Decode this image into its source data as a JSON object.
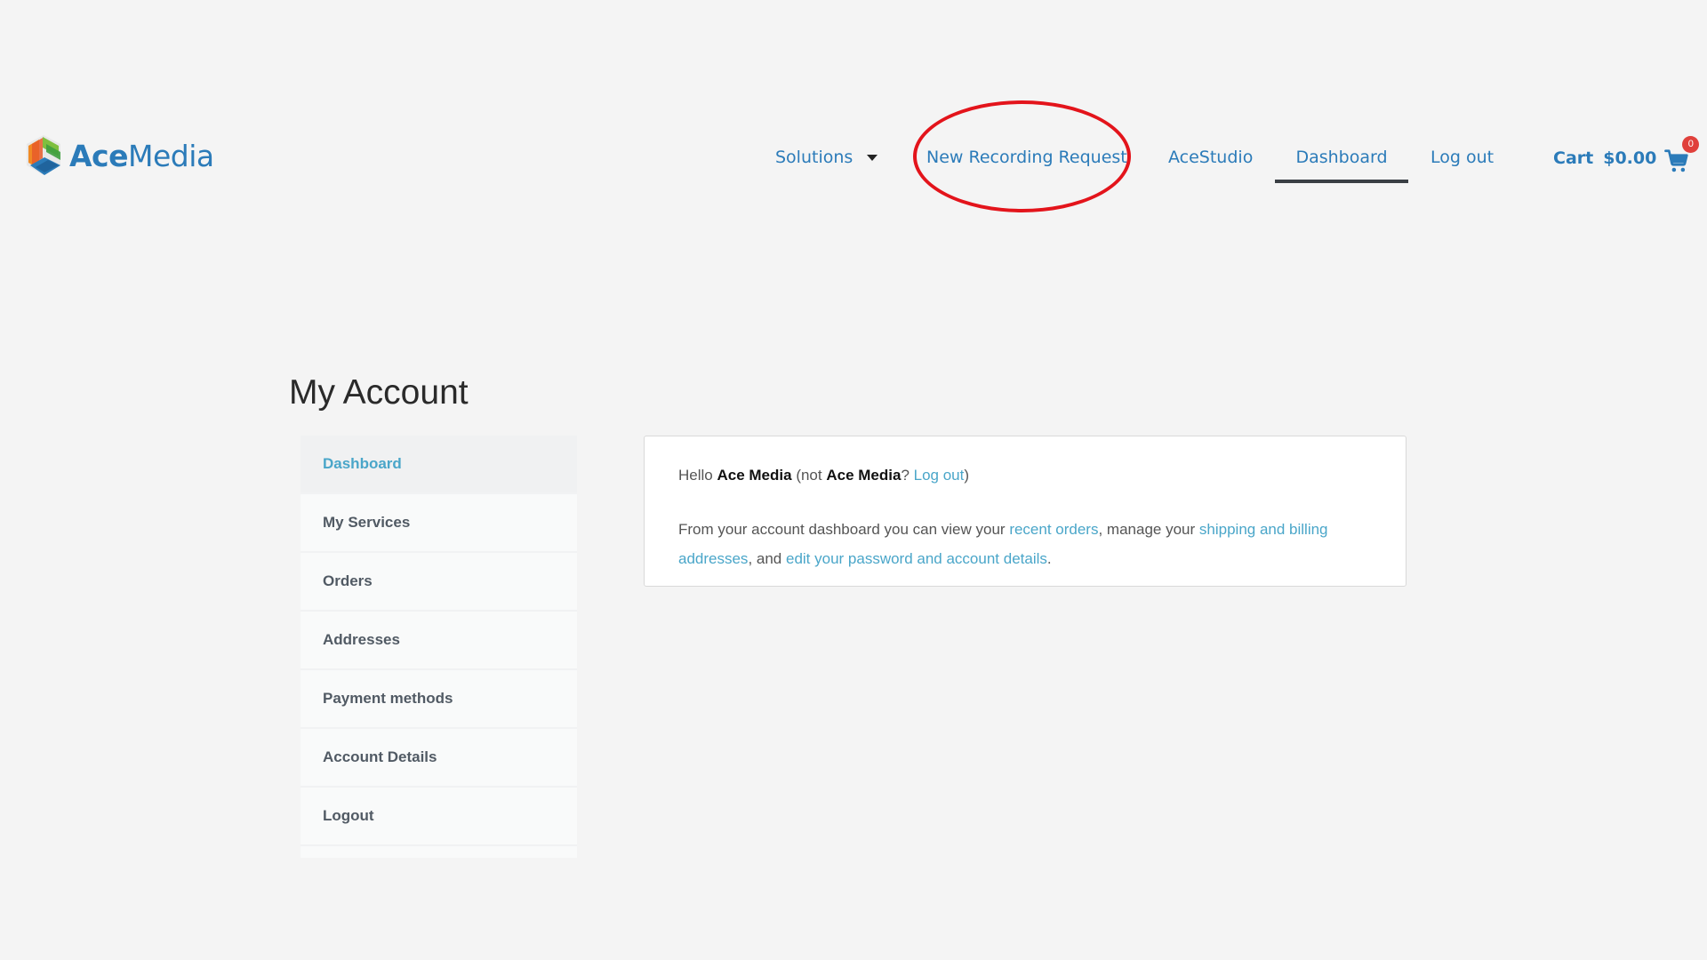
{
  "header": {
    "logo": {
      "ace": "Ace",
      "media": "Media"
    },
    "nav": {
      "solutions": "Solutions",
      "new_recording_request": "New Recording Request",
      "acestudio": "AceStudio",
      "dashboard": "Dashboard",
      "logout": "Log out"
    },
    "cart": {
      "label": "Cart",
      "amount": "$0.00",
      "count": "0"
    }
  },
  "page": {
    "title": "My Account"
  },
  "account_nav": {
    "items": [
      {
        "label": "Dashboard",
        "active": true
      },
      {
        "label": "My Services"
      },
      {
        "label": "Orders"
      },
      {
        "label": "Addresses"
      },
      {
        "label": "Payment methods"
      },
      {
        "label": "Account Details"
      },
      {
        "label": "Logout"
      }
    ]
  },
  "dashboard": {
    "hello": "Hello",
    "user_name": "Ace Media",
    "not_prefix": "(not",
    "not_user": "Ace Media",
    "question": "?",
    "logout_link": "Log out",
    "close_paren": ")",
    "intro": "From your account dashboard you can view your",
    "recent_orders_link": "recent orders",
    "manage": ", manage your",
    "addresses_link": "shipping and billing addresses",
    "and": ", and",
    "password_link": "edit your password and account details",
    "period": "."
  },
  "colors": {
    "brand_blue": "#2b7bb9",
    "link_blue": "#4aa6c9",
    "annotation_red": "#e3141b",
    "badge_red": "#e0403b"
  },
  "icons": {
    "logo": "acemedia-hexagon-logo",
    "cart": "shopping-cart-icon",
    "solutions_caret": "caret-down-icon"
  }
}
